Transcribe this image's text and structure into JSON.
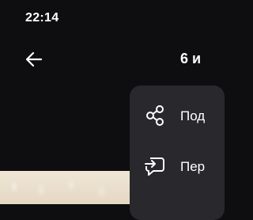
{
  "status_bar": {
    "time": "22:14"
  },
  "header": {
    "title": "6 и",
    "back_icon": "arrow-left-icon"
  },
  "context_menu": {
    "items": [
      {
        "label": "Под",
        "icon": "share-icon"
      },
      {
        "label": "Пер",
        "icon": "forward-icon"
      }
    ]
  }
}
